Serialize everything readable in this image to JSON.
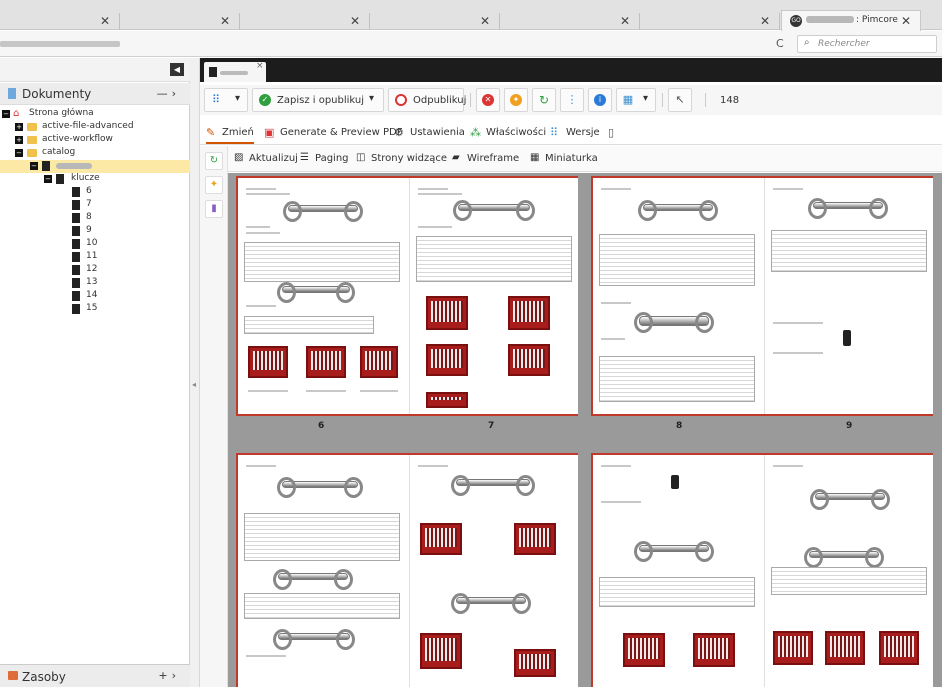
{
  "browser": {
    "active_tab_title": ": Pimcore",
    "active_tab_favicon": "GO",
    "search_placeholder": "Rechercher"
  },
  "left_panel": {
    "documents_label": "Dokumenty",
    "tree": [
      {
        "label": "Strona główna"
      },
      {
        "label": "active-file-advanced"
      },
      {
        "label": "active-workflow"
      },
      {
        "label": "catalog"
      },
      {
        "label": ""
      },
      {
        "label": "klucze"
      },
      {
        "label": "6"
      },
      {
        "label": "7"
      },
      {
        "label": "8"
      },
      {
        "label": "9"
      },
      {
        "label": "10"
      },
      {
        "label": "11"
      },
      {
        "label": "12"
      },
      {
        "label": "13"
      },
      {
        "label": "14"
      },
      {
        "label": "15"
      }
    ],
    "assets_label": "Zasoby"
  },
  "toolbar": {
    "save_publish": "Zapisz i opublikuj",
    "unpublish": "Odpublikuj",
    "count": "148"
  },
  "subtabs": {
    "edit": "Zmień",
    "generate_pdf": "Generate & Preview PDF",
    "settings": "Ustawienia",
    "properties": "Właściwości",
    "versions": "Wersje"
  },
  "print_toolbar": {
    "update": "Aktualizuj",
    "paging": "Paging",
    "visible_pages": "Strony widzące",
    "wireframe": "Wireframe",
    "thumbnail": "Miniaturka"
  },
  "pages": {
    "spread1_left": "6",
    "spread1_right": "7",
    "spread2_left": "8",
    "spread2_right": "9"
  },
  "colors": {
    "accent_orange": "#d35400",
    "page_border_red": "#c0392b",
    "save_green": "#2e9e3e",
    "unpublish_red": "#d33",
    "selected_row": "#fbe9a5"
  }
}
